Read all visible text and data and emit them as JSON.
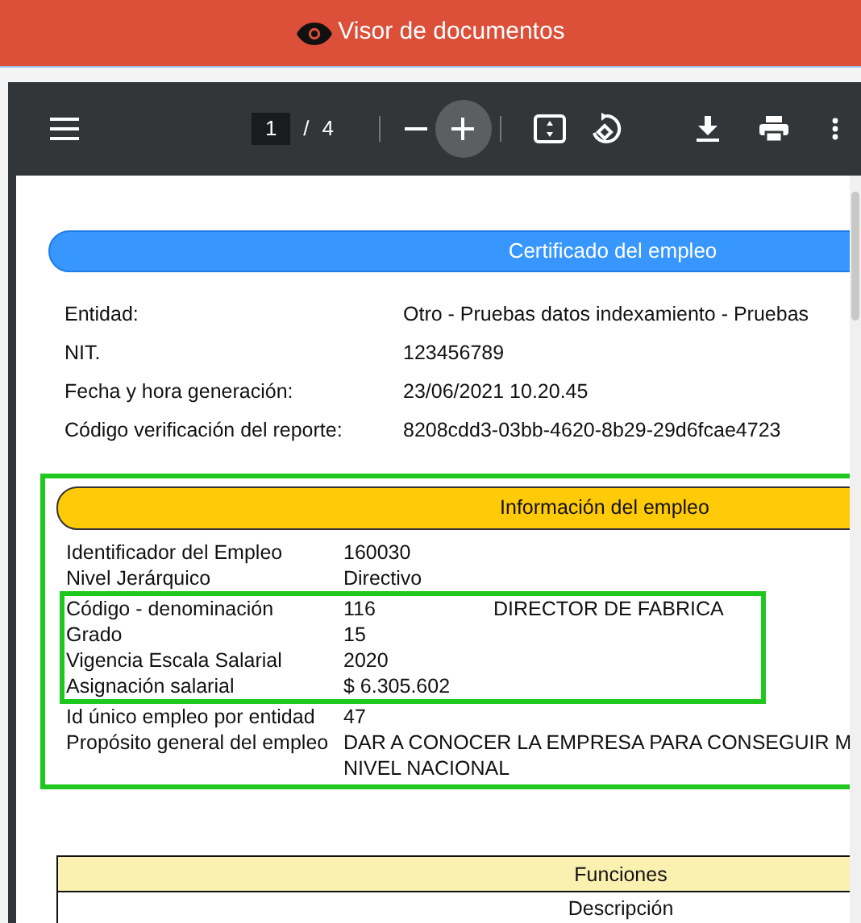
{
  "header": {
    "title": "Visor de documentos"
  },
  "toolbar": {
    "page_current": "1",
    "page_separator": "/",
    "page_total": "4"
  },
  "document": {
    "title": "Certificado del empleo",
    "general": [
      {
        "label": "Entidad:",
        "value": "Otro - Pruebas datos indexamiento - Pruebas"
      },
      {
        "label": "NIT.",
        "value": "123456789"
      },
      {
        "label": "Fecha y hora generación:",
        "value": "23/06/2021 10.20.45"
      },
      {
        "label": "Código verificación del reporte:",
        "value": "8208cdd3-03bb-4620-8b29-29d6fcae4723"
      }
    ],
    "info": {
      "title": "Información del empleo",
      "highlighted": true,
      "rows": [
        {
          "label": "Identificador del Empleo",
          "values": [
            "160030"
          ],
          "highlighted": false
        },
        {
          "label": "Nivel Jerárquico",
          "values": [
            "Directivo"
          ],
          "highlighted": false
        },
        {
          "label": "Código - denominación",
          "values": [
            "116",
            "DIRECTOR DE FABRICA"
          ],
          "highlighted": true
        },
        {
          "label": "Grado",
          "values": [
            "15"
          ],
          "highlighted": true
        },
        {
          "label": "Vigencia Escala Salarial",
          "values": [
            "2020"
          ],
          "highlighted": true
        },
        {
          "label": "Asignación salarial",
          "values": [
            "$ 6.305.602"
          ],
          "highlighted": true
        },
        {
          "label": "Id único empleo por entidad",
          "values": [
            "47"
          ],
          "highlighted": false
        },
        {
          "label": "Propósito general del empleo",
          "lines": [
            "DAR A CONOCER LA EMPRESA PARA CONSEGUIR M",
            "NIVEL NACIONAL"
          ],
          "highlighted": false
        }
      ]
    },
    "table": {
      "title": "Funciones",
      "column": "Descripción"
    }
  }
}
